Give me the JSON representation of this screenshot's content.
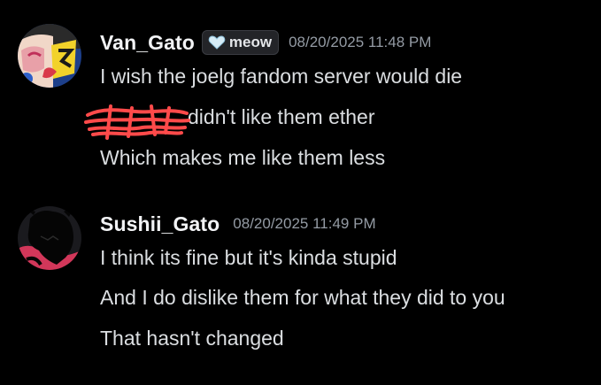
{
  "messages": [
    {
      "username": "Van_Gato",
      "tag": {
        "icon": "heart-icon",
        "label": "meow"
      },
      "timestamp": "08/20/2025 11:48 PM",
      "lines": [
        "I wish the joelg fandom server would die",
        "didn't like them ether",
        "Which makes me like them less"
      ]
    },
    {
      "username": "Sushii_Gato",
      "timestamp": "08/20/2025 11:49 PM",
      "lines": [
        "I think its fine but it's kinda stupid",
        "And I do dislike them for what they did to you",
        "That hasn't changed"
      ]
    }
  ],
  "colors": {
    "background": "#000000",
    "username": "#f2f3f5",
    "message_text": "#dbdee1",
    "timestamp": "#949ba4",
    "redaction_scribble": "#ff4a4a"
  }
}
